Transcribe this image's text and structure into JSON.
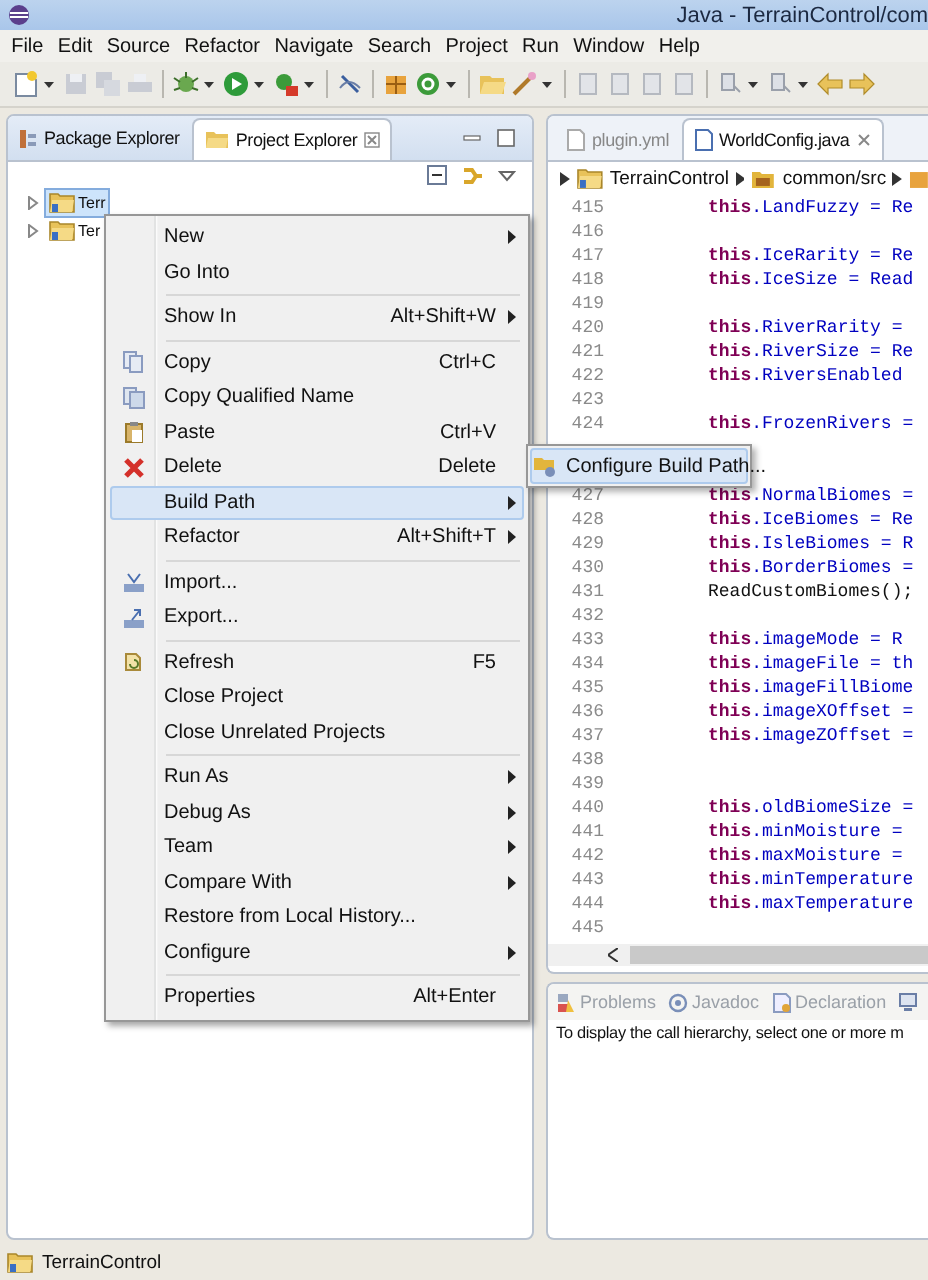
{
  "window": {
    "title": "Java - TerrainControl/com"
  },
  "menu_bar": [
    "File",
    "Edit",
    "Source",
    "Refactor",
    "Navigate",
    "Search",
    "Project",
    "Run",
    "Window",
    "Help"
  ],
  "project_panel": {
    "tabs": [
      {
        "label": "Package Explorer",
        "selected": false
      },
      {
        "label": "Project Explorer",
        "selected": true
      }
    ],
    "tree": [
      {
        "label": "Terr",
        "selected": true,
        "expanded": false
      },
      {
        "label": "Ter",
        "selected": false,
        "expanded": false
      }
    ]
  },
  "context_menu": {
    "items": [
      {
        "kind": "item",
        "label": "New",
        "submenu": true,
        "selected": false
      },
      {
        "kind": "item",
        "label": "Go Into",
        "selected": false
      },
      {
        "kind": "separator"
      },
      {
        "kind": "item",
        "label": "Show In",
        "shortcut": "Alt+Shift+W",
        "submenu": true,
        "selected": false
      },
      {
        "kind": "separator"
      },
      {
        "kind": "item",
        "label": "Copy",
        "shortcut": "Ctrl+C",
        "selected": false
      },
      {
        "kind": "item",
        "label": "Copy Qualified Name",
        "selected": false
      },
      {
        "kind": "item",
        "label": "Paste",
        "shortcut": "Ctrl+V",
        "selected": false
      },
      {
        "kind": "item",
        "label": "Delete",
        "shortcut": "Delete",
        "selected": false
      },
      {
        "kind": "item",
        "label": "Build Path",
        "submenu": true,
        "selected": true
      },
      {
        "kind": "item",
        "label": "Refactor",
        "shortcut": "Alt+Shift+T",
        "submenu": true,
        "selected": false
      },
      {
        "kind": "separator"
      },
      {
        "kind": "item",
        "label": "Import...",
        "selected": false
      },
      {
        "kind": "item",
        "label": "Export...",
        "selected": false
      },
      {
        "kind": "separator"
      },
      {
        "kind": "item",
        "label": "Refresh",
        "shortcut": "F5",
        "selected": false
      },
      {
        "kind": "item",
        "label": "Close Project",
        "selected": false
      },
      {
        "kind": "item",
        "label": "Close Unrelated Projects",
        "selected": false
      },
      {
        "kind": "separator"
      },
      {
        "kind": "item",
        "label": "Run As",
        "submenu": true,
        "selected": false
      },
      {
        "kind": "item",
        "label": "Debug As",
        "submenu": true,
        "selected": false
      },
      {
        "kind": "item",
        "label": "Team",
        "submenu": true,
        "selected": false
      },
      {
        "kind": "item",
        "label": "Compare With",
        "submenu": true,
        "selected": false
      },
      {
        "kind": "item",
        "label": "Restore from Local History...",
        "selected": false
      },
      {
        "kind": "item",
        "label": "Configure",
        "submenu": true,
        "selected": false
      },
      {
        "kind": "separator"
      },
      {
        "kind": "item",
        "label": "Properties",
        "shortcut": "Alt+Enter",
        "selected": false
      }
    ]
  },
  "submenu": {
    "items": [
      {
        "label": "Configure Build Path...",
        "selected": true
      }
    ]
  },
  "editor": {
    "tabs": [
      {
        "label": "plugin.yml",
        "selected": false
      },
      {
        "label": "WorldConfig.java",
        "selected": true
      }
    ],
    "breadcrumb": [
      "TerrainControl",
      "common/src"
    ],
    "lines": [
      {
        "num": "415",
        "keyword": "this",
        "code": ".LandFuzzy = Re"
      },
      {
        "num": "416"
      },
      {
        "num": "417",
        "keyword": "this",
        "code": ".IceRarity = Re"
      },
      {
        "num": "418",
        "keyword": "this",
        "code": ".IceSize = Read"
      },
      {
        "num": "419"
      },
      {
        "num": "420",
        "keyword": "this",
        "code": ".RiverRarity ="
      },
      {
        "num": "421",
        "keyword": "this",
        "code": ".RiverSize = Re"
      },
      {
        "num": "422",
        "keyword": "this",
        "code": ".RiversEnabled"
      },
      {
        "num": "423"
      },
      {
        "num": "424",
        "keyword": "this",
        "code": ".FrozenRivers ="
      },
      {
        "hidden": true
      },
      {
        "hidden": true
      },
      {
        "num": "427",
        "keyword": "this",
        "code": ".NormalBiomes ="
      },
      {
        "num": "428",
        "keyword": "this",
        "code": ".IceBiomes = Re"
      },
      {
        "num": "429",
        "keyword": "this",
        "code": ".IsleBiomes = R"
      },
      {
        "num": "430",
        "keyword": "this",
        "code": ".BorderBiomes ="
      },
      {
        "num": "431",
        "code": "ReadCustomBiomes();"
      },
      {
        "num": "432"
      },
      {
        "num": "433",
        "keyword": "this",
        "code": ".imageMode =  R"
      },
      {
        "num": "434",
        "keyword": "this",
        "code": ".imageFile = th"
      },
      {
        "num": "435",
        "keyword": "this",
        "code": ".imageFillBiome"
      },
      {
        "num": "436",
        "keyword": "this",
        "code": ".imageXOffset ="
      },
      {
        "num": "437",
        "keyword": "this",
        "code": ".imageZOffset ="
      },
      {
        "num": "438"
      },
      {
        "num": "439"
      },
      {
        "num": "440",
        "keyword": "this",
        "code": ".oldBiomeSize ="
      },
      {
        "num": "441",
        "keyword": "this",
        "code": ".minMoisture ="
      },
      {
        "num": "442",
        "keyword": "this",
        "code": ".maxMoisture ="
      },
      {
        "num": "443",
        "keyword": "this",
        "code": ".minTemperature"
      },
      {
        "num": "444",
        "keyword": "this",
        "code": ".maxTemperature"
      },
      {
        "num": "445"
      }
    ]
  },
  "bottom_panel": {
    "tabs": [
      {
        "label": "Problems",
        "selected": false
      },
      {
        "label": "Javadoc",
        "selected": false
      },
      {
        "label": "Declaration",
        "selected": false
      }
    ],
    "message": "To display the call hierarchy, select one or more m"
  },
  "status_bar": {
    "text": "TerrainControl"
  }
}
